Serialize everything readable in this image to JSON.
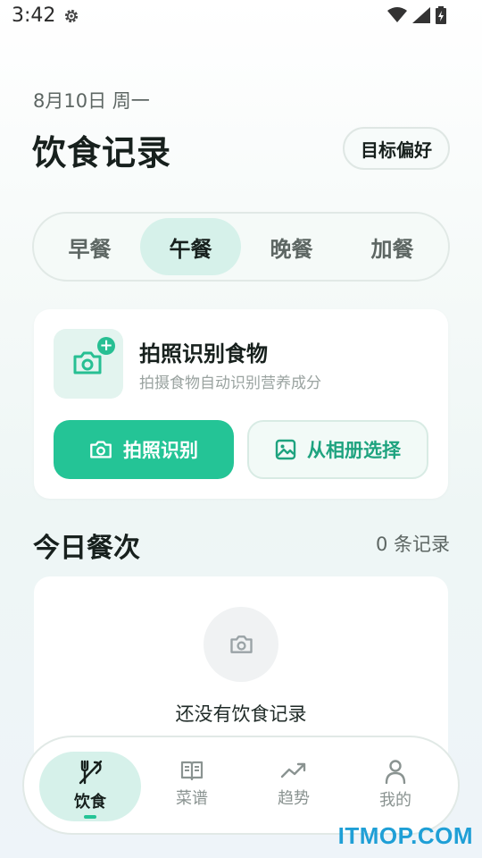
{
  "status_bar": {
    "time": "3:42"
  },
  "header": {
    "date": "8月10日 周一",
    "title": "饮食记录",
    "pref_label": "目标偏好"
  },
  "meal_tabs": [
    {
      "label": "早餐",
      "active": false
    },
    {
      "label": "午餐",
      "active": true
    },
    {
      "label": "晚餐",
      "active": false
    },
    {
      "label": "加餐",
      "active": false
    }
  ],
  "photo_card": {
    "title": "拍照识别食物",
    "subtitle": "拍摄食物自动识别营养成分",
    "take_photo_label": "拍照识别",
    "album_label": "从相册选择",
    "accent": "#24c496"
  },
  "today": {
    "title": "今日餐次",
    "count": "0 条记录",
    "empty_text": "还没有饮食记录"
  },
  "bottom_nav": [
    {
      "label": "饮食",
      "icon": "utensils-icon",
      "active": true
    },
    {
      "label": "菜谱",
      "icon": "book-icon",
      "active": false
    },
    {
      "label": "趋势",
      "icon": "trend-icon",
      "active": false
    },
    {
      "label": "我的",
      "icon": "user-icon",
      "active": false
    }
  ],
  "watermark": "ITMOP.COM"
}
